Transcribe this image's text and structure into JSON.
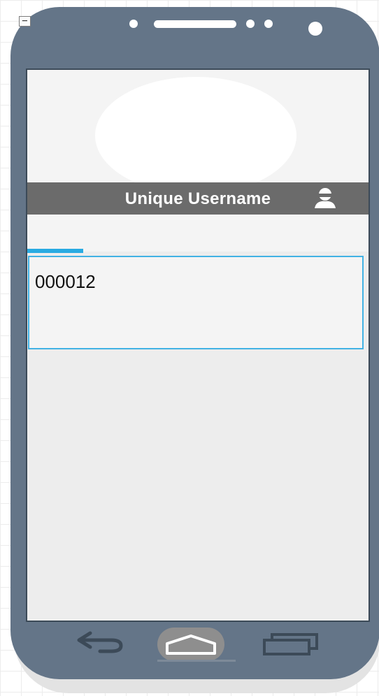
{
  "header": {
    "title": "Unique Username",
    "icon": "user-icon"
  },
  "field": {
    "value": "000012"
  },
  "frame": {
    "collapse_symbol": "−"
  },
  "nav": {
    "back_icon": "back-arrow-icon",
    "home_icon": "home-icon",
    "recent_icon": "recent-apps-icon"
  },
  "colors": {
    "phone_frame": "#647588",
    "header_bar": "#6b6b6b",
    "focus_accent": "#29abe2"
  }
}
